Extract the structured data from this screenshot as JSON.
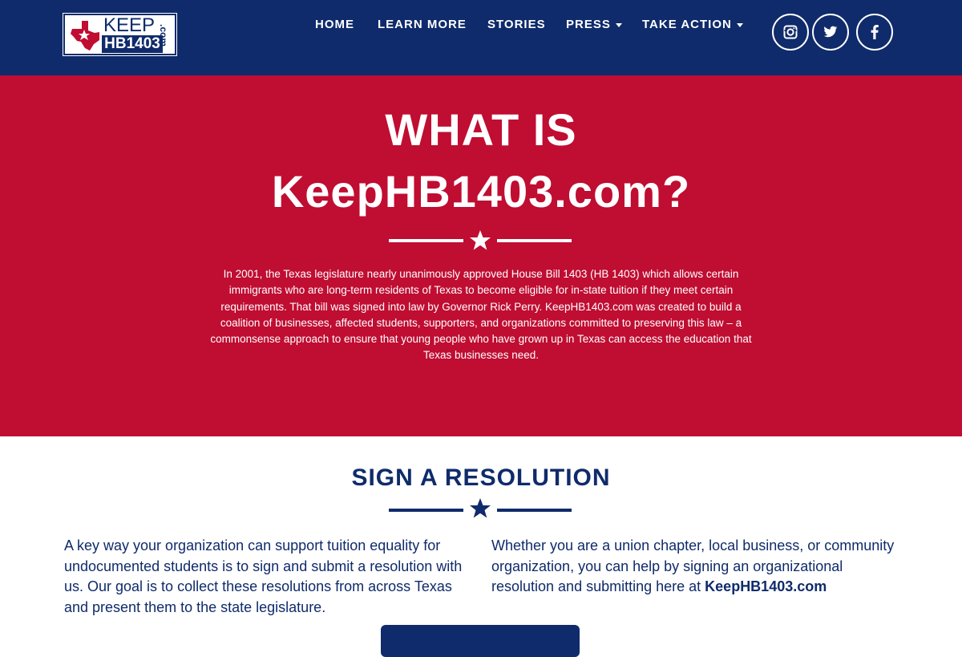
{
  "brand": {
    "logo_keep": "KEEP",
    "logo_hb": "HB1403",
    "logo_com": ".com",
    "color_navy": "#0f2b6b",
    "color_red": "#c00d32"
  },
  "nav": {
    "items": [
      {
        "label": "HOME"
      },
      {
        "label": "LEARN MORE"
      },
      {
        "label": "STORIES"
      },
      {
        "label": "PRESS"
      },
      {
        "label": "TAKE ACTION"
      }
    ],
    "social": [
      {
        "icon": "instagram-icon"
      },
      {
        "icon": "twitter-icon"
      },
      {
        "icon": "facebook-icon"
      }
    ]
  },
  "hero": {
    "title_line1": "WHAT IS",
    "title_line2": "KeepHB1403.com?",
    "body": "In 2001, the Texas legislature nearly unanimously approved House Bill 1403 (HB 1403) which allows certain immigrants who are long-term residents of Texas to become eligible for in-state tuition if they meet certain requirements. That bill was signed into law by Governor Rick Perry. KeepHB1403.com was created to build a coalition of businesses, affected students, supporters, and organizations committed to preserving this law – a commonsense approach to ensure that young people who have grown up in Texas can access the education that Texas businesses need."
  },
  "resolution": {
    "title": "SIGN A RESOLUTION",
    "left_text": "A key way your organization can support tuition equality for undocumented students is to sign and submit a resolution with us. Our goal is to collect these resolutions from across Texas and present them to the state legislature.",
    "right_text": "Whether you are a union chapter, local business, or community organization, you can help by signing an organizational resolution and submitting here at ",
    "right_link": "KeepHB1403.com"
  }
}
